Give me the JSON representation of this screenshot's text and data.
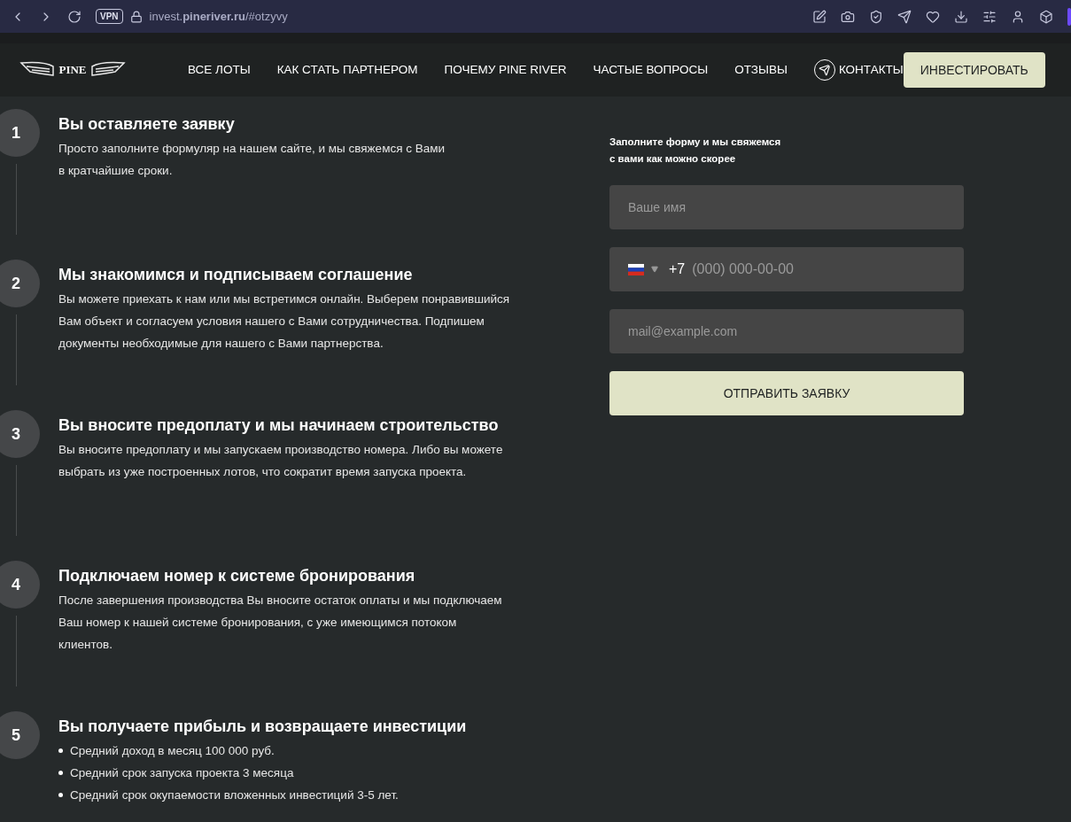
{
  "browser": {
    "badge": "VPN",
    "url": "invest.**pineriver.ru**/#otzyvy"
  },
  "nav": {
    "logo_text": "PINE",
    "links": [
      {
        "label": "ВСЕ ЛОТЫ"
      },
      {
        "label": "КАК СТАТЬ ПАРТНЕРОМ"
      },
      {
        "label": "ПОЧЕМУ PINE RIVER"
      },
      {
        "label": "ЧАСТЫЕ ВОПРОСЫ"
      },
      {
        "label": "ОТЗЫВЫ"
      },
      {
        "label": "КОНТАКТЫ"
      }
    ],
    "cta": "ИНВЕСТИРОВАТЬ"
  },
  "steps": [
    {
      "number": "1",
      "title": "Вы оставляете заявку",
      "kind": "text",
      "lines": [
        "Просто заполните формуляр на нашем сайте, и мы свяжемся с Вами",
        "в кратчайшие сроки."
      ]
    },
    {
      "number": "2",
      "title": "Мы знакомимся и подписываем соглашение",
      "kind": "text",
      "lines": [
        "Вы можете приехать к нам или мы встретимся онлайн. Выберем понравившийся",
        "Вам объект и согласуем условия нашего с Вами сотрудничества. Подпишем",
        "документы необходимые для нашего с Вами партнерства."
      ]
    },
    {
      "number": "3",
      "title": "Вы вносите предоплату и мы начинаем строительство",
      "kind": "text",
      "lines": [
        "Вы вносите предоплату и мы запускаем производство номера. Либо вы можете",
        "выбрать из уже построенных лотов, что сократит время запуска проекта."
      ]
    },
    {
      "number": "4",
      "title": "Подключаем номер к системе бронирования",
      "kind": "text",
      "lines": [
        "После завершения производства Вы вносите остаток оплаты и мы подключаем",
        "Ваш номер к нашей системе бронирования, с уже имеющимся потоком",
        "клиентов."
      ]
    },
    {
      "number": "5",
      "title": "Вы получаете прибыль и возвращаете инвестиции",
      "kind": "bullets",
      "lines": [
        "Средний доход в месяц 100 000 руб.",
        "Средний срок запуска проекта 3 месяца",
        "Средний срок окупаемости вложенных инвестиций 3-5 лет."
      ]
    }
  ],
  "form": {
    "heading": [
      "Заполните форму и мы свяжемся",
      "с вами как можно скорее"
    ],
    "name_placeholder": "Ваше имя",
    "phone_code": "+7",
    "phone_placeholder": "(000) 000-00-00",
    "email_placeholder": "mail@example.com",
    "submit": "ОТПРАВИТЬ ЗАЯВКУ"
  }
}
